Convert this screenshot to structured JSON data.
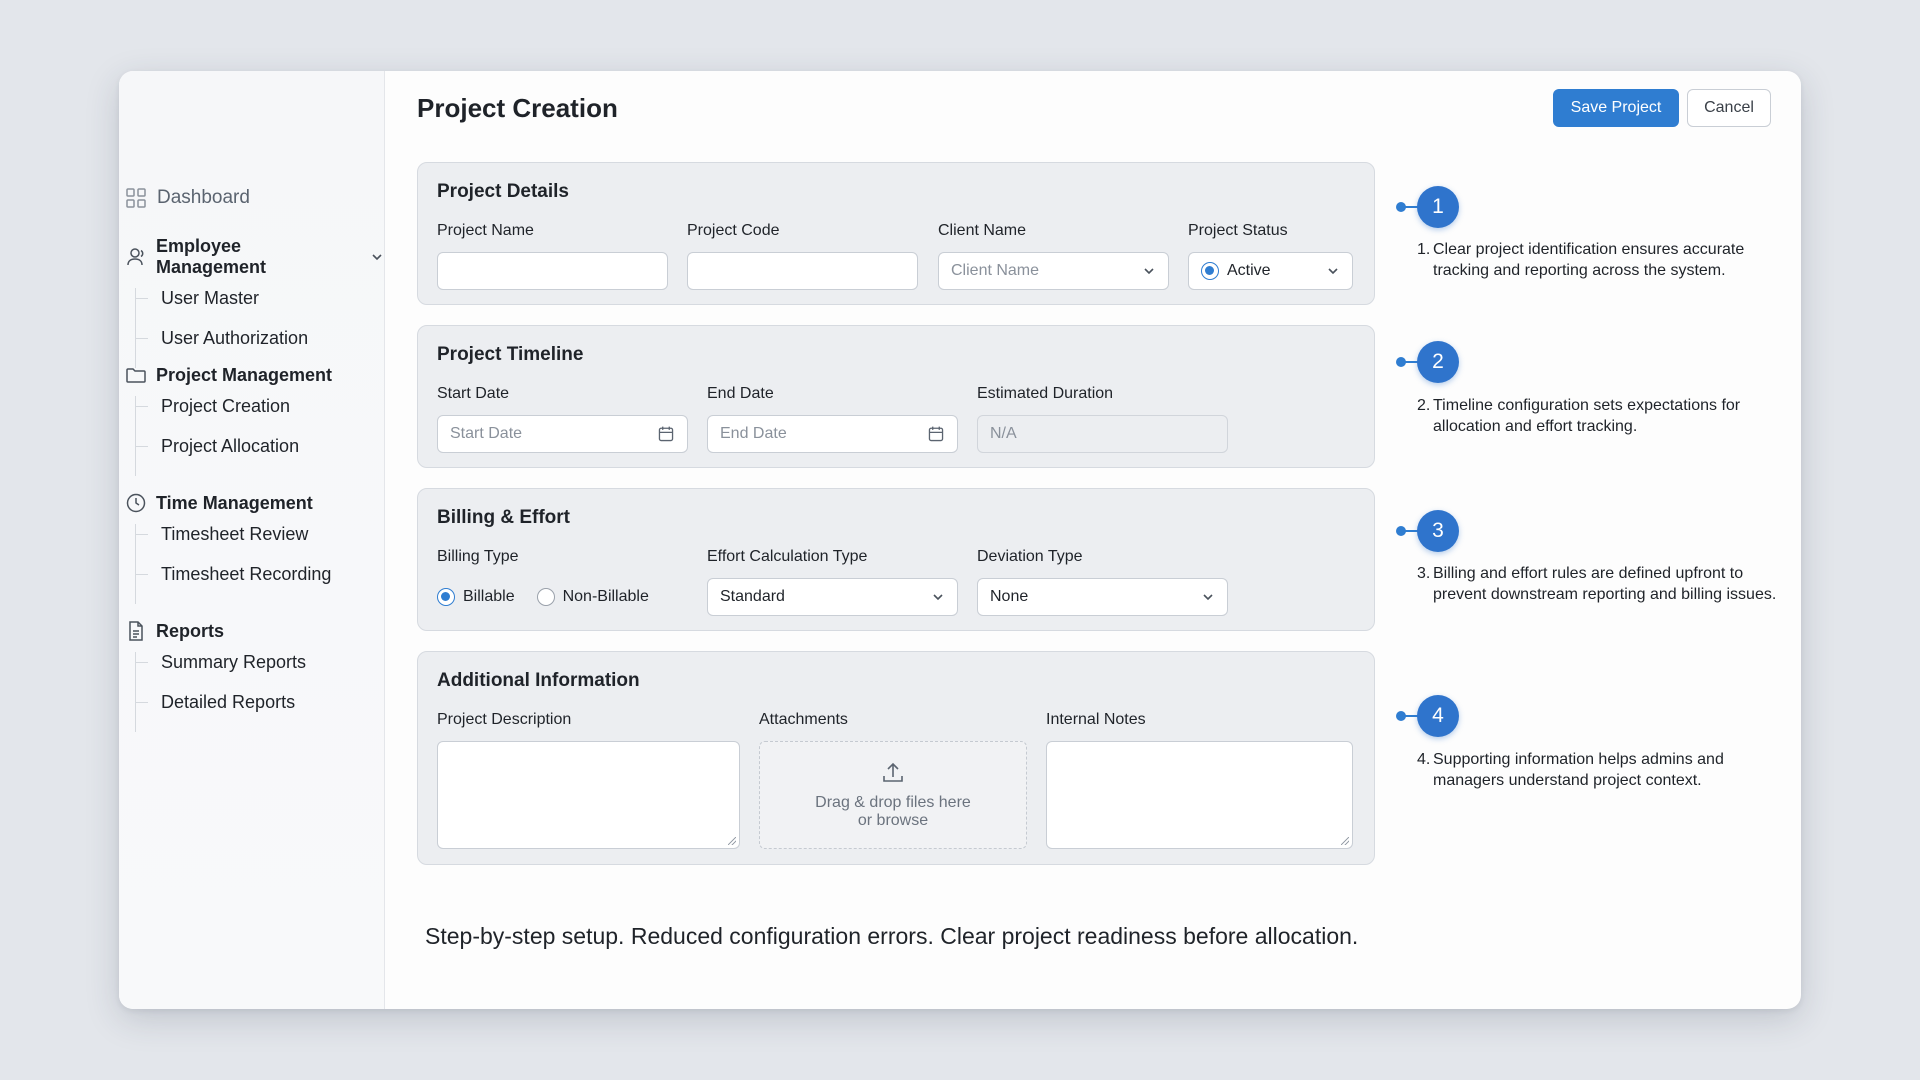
{
  "sidebar": {
    "dashboard": "Dashboard",
    "groups": [
      {
        "label": "Employee Management",
        "items": [
          "User Master",
          "User Authorization"
        ]
      },
      {
        "label": "Project Management",
        "items": [
          "Project Creation",
          "Project Allocation"
        ]
      },
      {
        "label": "Time Management",
        "items": [
          "Timesheet Review",
          "Timesheet Recording"
        ]
      },
      {
        "label": "Reports",
        "items": [
          "Summary Reports",
          "Detailed Reports"
        ]
      }
    ]
  },
  "header": {
    "title": "Project Creation",
    "save_label": "Save Project",
    "cancel_label": "Cancel"
  },
  "sections": {
    "details": {
      "title": "Project Details",
      "project_name_label": "Project Name",
      "project_code_label": "Project Code",
      "client_name_label": "Client Name",
      "client_name_placeholder": "Client Name",
      "project_status_label": "Project Status",
      "project_status_value": "Active"
    },
    "timeline": {
      "title": "Project Timeline",
      "start_label": "Start Date",
      "start_placeholder": "Start Date",
      "end_label": "End Date",
      "end_placeholder": "End Date",
      "duration_label": "Estimated Duration",
      "duration_value": "N/A"
    },
    "billing": {
      "title": "Billing & Effort",
      "billing_type_label": "Billing Type",
      "billable": "Billable",
      "non_billable": "Non-Billable",
      "effort_label": "Effort Calculation Type",
      "effort_value": "Standard",
      "deviation_label": "Deviation Type",
      "deviation_value": "None"
    },
    "additional": {
      "title": "Additional Information",
      "description_label": "Project Description",
      "attachments_label": "Attachments",
      "dropzone_line1": "Drag & drop files here",
      "dropzone_line2": "or browse",
      "notes_label": "Internal Notes"
    }
  },
  "annotations": [
    {
      "badge": "1",
      "num": "1.",
      "text": "Clear project identification ensures accurate tracking and reporting across the system."
    },
    {
      "badge": "2",
      "num": "2.",
      "text": "Timeline configuration sets expectations for allocation and effort tracking."
    },
    {
      "badge": "3",
      "num": "3.",
      "text": "Billing and effort rules are defined upfront to prevent downstream reporting and billing issues."
    },
    {
      "badge": "4",
      "num": "4.",
      "text": "Supporting information helps admins and managers understand project context."
    }
  ],
  "footer": "Step-by-step setup. Reduced configuration errors. Clear project readiness before allocation.",
  "colors": {
    "accent": "#2f7dd1",
    "badge": "#2f74cc",
    "card_bg": "#eceef1",
    "page_bg": "#e3e6eb"
  },
  "icons": {
    "dashboard": "grid-icon",
    "employee": "user-icon",
    "project": "folder-icon",
    "time": "clock-icon",
    "reports": "document-icon",
    "calendar": "calendar-icon",
    "upload": "upload-icon",
    "chevron": "chevron-down-icon"
  }
}
